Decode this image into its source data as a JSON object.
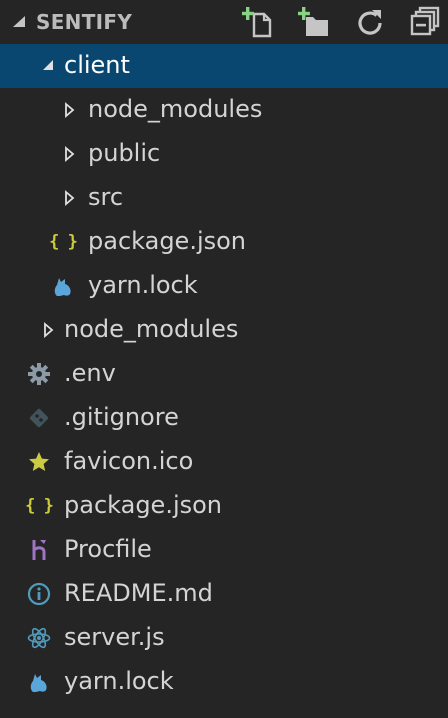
{
  "panel": {
    "title": "SENTIFY",
    "actions": [
      {
        "name": "new-file-icon"
      },
      {
        "name": "new-folder-icon"
      },
      {
        "name": "refresh-icon"
      },
      {
        "name": "collapse-all-icon"
      }
    ]
  },
  "tree": [
    {
      "label": "client",
      "type": "folder",
      "expanded": true,
      "depth": 1,
      "icon": "chevron-down-icon",
      "selected": true
    },
    {
      "label": "node_modules",
      "type": "folder",
      "expanded": false,
      "depth": 2,
      "icon": "chevron-right-icon"
    },
    {
      "label": "public",
      "type": "folder",
      "expanded": false,
      "depth": 2,
      "icon": "chevron-right-icon"
    },
    {
      "label": "src",
      "type": "folder",
      "expanded": false,
      "depth": 2,
      "icon": "chevron-right-icon"
    },
    {
      "label": "package.json",
      "type": "file",
      "depth": 2,
      "icon": "json-file-icon"
    },
    {
      "label": "yarn.lock",
      "type": "file",
      "depth": 2,
      "icon": "yarn-icon"
    },
    {
      "label": "node_modules",
      "type": "folder",
      "expanded": false,
      "depth": 1,
      "icon": "chevron-right-icon"
    },
    {
      "label": ".env",
      "type": "file",
      "depth": 1,
      "icon": "gear-icon"
    },
    {
      "label": ".gitignore",
      "type": "file",
      "depth": 1,
      "icon": "git-icon"
    },
    {
      "label": "favicon.ico",
      "type": "file",
      "depth": 1,
      "icon": "star-icon"
    },
    {
      "label": "package.json",
      "type": "file",
      "depth": 1,
      "icon": "json-file-icon"
    },
    {
      "label": "Procfile",
      "type": "file",
      "depth": 1,
      "icon": "heroku-icon"
    },
    {
      "label": "README.md",
      "type": "file",
      "depth": 1,
      "icon": "info-icon"
    },
    {
      "label": "server.js",
      "type": "file",
      "depth": 1,
      "icon": "react-icon"
    },
    {
      "label": "yarn.lock",
      "type": "file",
      "depth": 1,
      "icon": "yarn-icon"
    }
  ],
  "colors": {
    "background": "#252526",
    "selection": "#094771",
    "json": "#cbcb41",
    "yarn": "#5aa5d9",
    "gear": "#8c99a6",
    "git": "#41535b",
    "star": "#cbcb41",
    "heroku": "#a074c4",
    "info": "#519aba",
    "react": "#519aba"
  }
}
